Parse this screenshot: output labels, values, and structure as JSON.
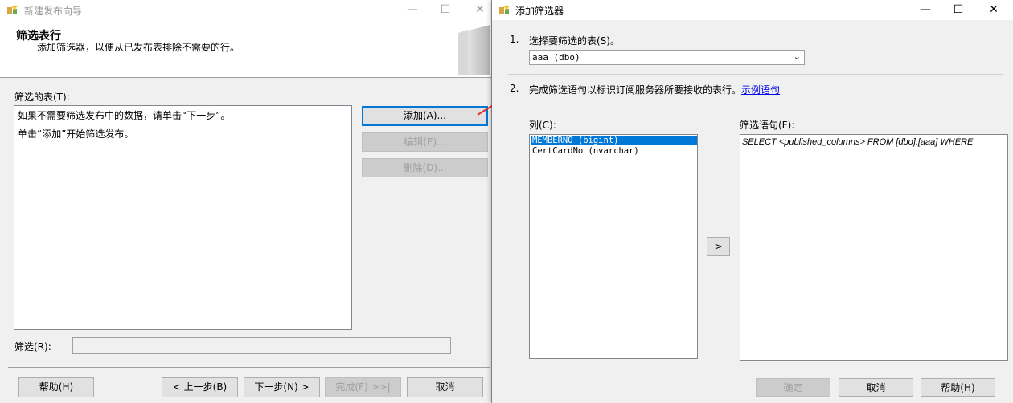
{
  "left": {
    "title": "新建发布向导",
    "header_title": "筛选表行",
    "header_subtitle": "添加筛选器，以便从已发布表排除不需要的行。",
    "filtered_tables_label": "筛选的表(T):",
    "list_lines": [
      "如果不需要筛选发布中的数据，请单击“下一步”。",
      "单击“添加”开始筛选发布。"
    ],
    "add_button": "添加(A)...",
    "edit_button": "编辑(E)...",
    "delete_button": "删除(D)...",
    "filter_label": "筛选(R):",
    "help_button": "帮助(H)",
    "back_button": "< 上一步(B)",
    "next_button": "下一步(N) >",
    "finish_button": "完成(F) >>|",
    "cancel_button": "取消"
  },
  "right": {
    "title": "添加筛选器",
    "step1_num": "1.",
    "step1_text": "选择要筛选的表(S)。",
    "table_select_value": "aaa (dbo)",
    "step2_num": "2.",
    "step2_text": "完成筛选语句以标识订阅服务器所要接收的表行。",
    "example_link": "示例语句",
    "columns_label": "列(C):",
    "columns": [
      "MEMBERNO (bigint)",
      "CertCardNo (nvarchar)"
    ],
    "add_column_button": ">",
    "filter_statement_label": "筛选语句(F):",
    "filter_statement": "SELECT <published_columns> FROM [dbo].[aaa] WHERE",
    "ok_button": "确定",
    "cancel_button": "取消",
    "help_button": "帮助(H)"
  },
  "colors": {
    "accent": "#0078d7",
    "selection": "#0078d7",
    "arrow": "#e03030",
    "link": "#0000ee"
  }
}
